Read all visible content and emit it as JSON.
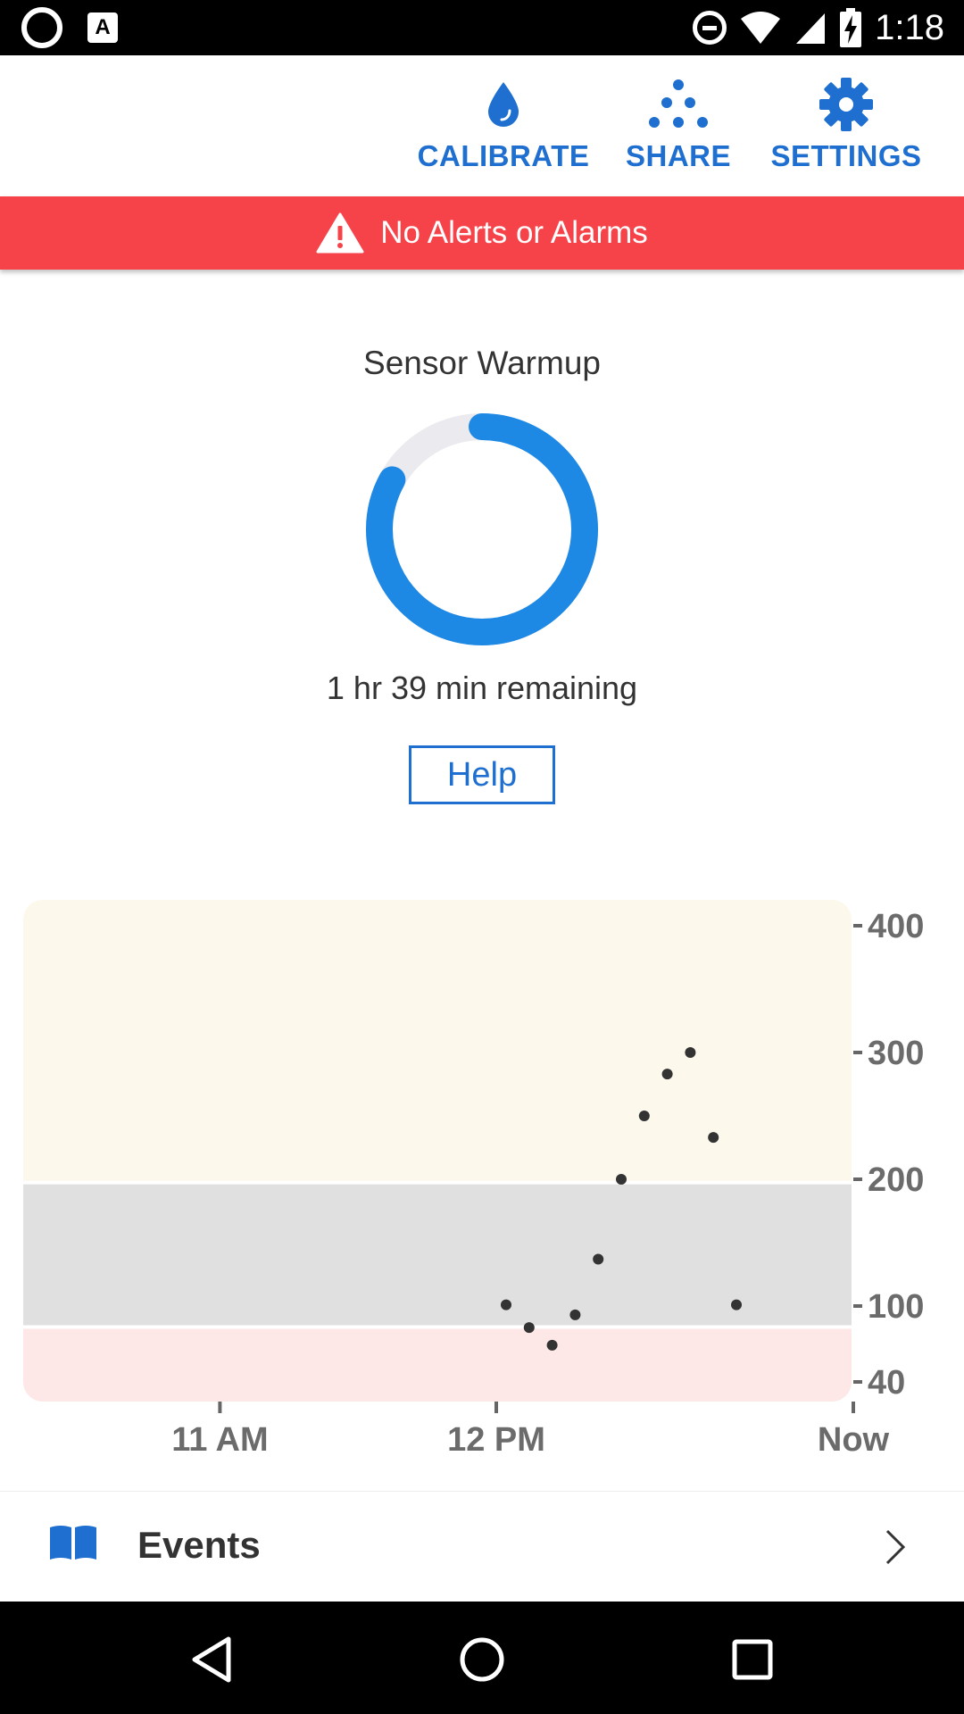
{
  "status_bar": {
    "time": "1:18",
    "notif_icon_letter": "A"
  },
  "toolbar": {
    "calibrate_label": "CALIBRATE",
    "share_label": "SHARE",
    "settings_label": "SETTINGS"
  },
  "alert": {
    "text": "No Alerts or Alarms",
    "color": "#f64249",
    "icon": "warning-icon"
  },
  "warmup": {
    "title": "Sensor Warmup",
    "remaining": "1 hr 39 min remaining",
    "progress_fraction": 0.83,
    "help_label": "Help"
  },
  "colors": {
    "accent": "#1e6fd0",
    "ring": "#1e88e5",
    "ring_track": "#ebebef"
  },
  "chart_data": {
    "type": "scatter",
    "y_ticks": [
      400,
      300,
      200,
      100,
      40
    ],
    "y_tick_labels": [
      "400",
      "300",
      "200",
      "100",
      "40"
    ],
    "x_tick_labels": [
      "11 AM",
      "12 PM",
      "Now"
    ],
    "ylim": [
      40,
      420
    ],
    "bands": [
      {
        "name": "high",
        "from": 196,
        "to": 420,
        "color": "#fdf8ec"
      },
      {
        "name": "target",
        "from": 82,
        "to": 196,
        "color": "#e0e0e0"
      },
      {
        "name": "low",
        "from": 40,
        "to": 82,
        "color": "#fde7e7"
      }
    ],
    "points": [
      {
        "x_min": 0,
        "y": 101
      },
      {
        "x_min": 5,
        "y": 83
      },
      {
        "x_min": 10,
        "y": 69
      },
      {
        "x_min": 15,
        "y": 93
      },
      {
        "x_min": 20,
        "y": 137
      },
      {
        "x_min": 25,
        "y": 200
      },
      {
        "x_min": 30,
        "y": 250
      },
      {
        "x_min": 35,
        "y": 283
      },
      {
        "x_min": 40,
        "y": 300
      },
      {
        "x_min": 45,
        "y": 233
      },
      {
        "x_min": 50,
        "y": 101
      }
    ]
  },
  "events": {
    "label": "Events"
  }
}
